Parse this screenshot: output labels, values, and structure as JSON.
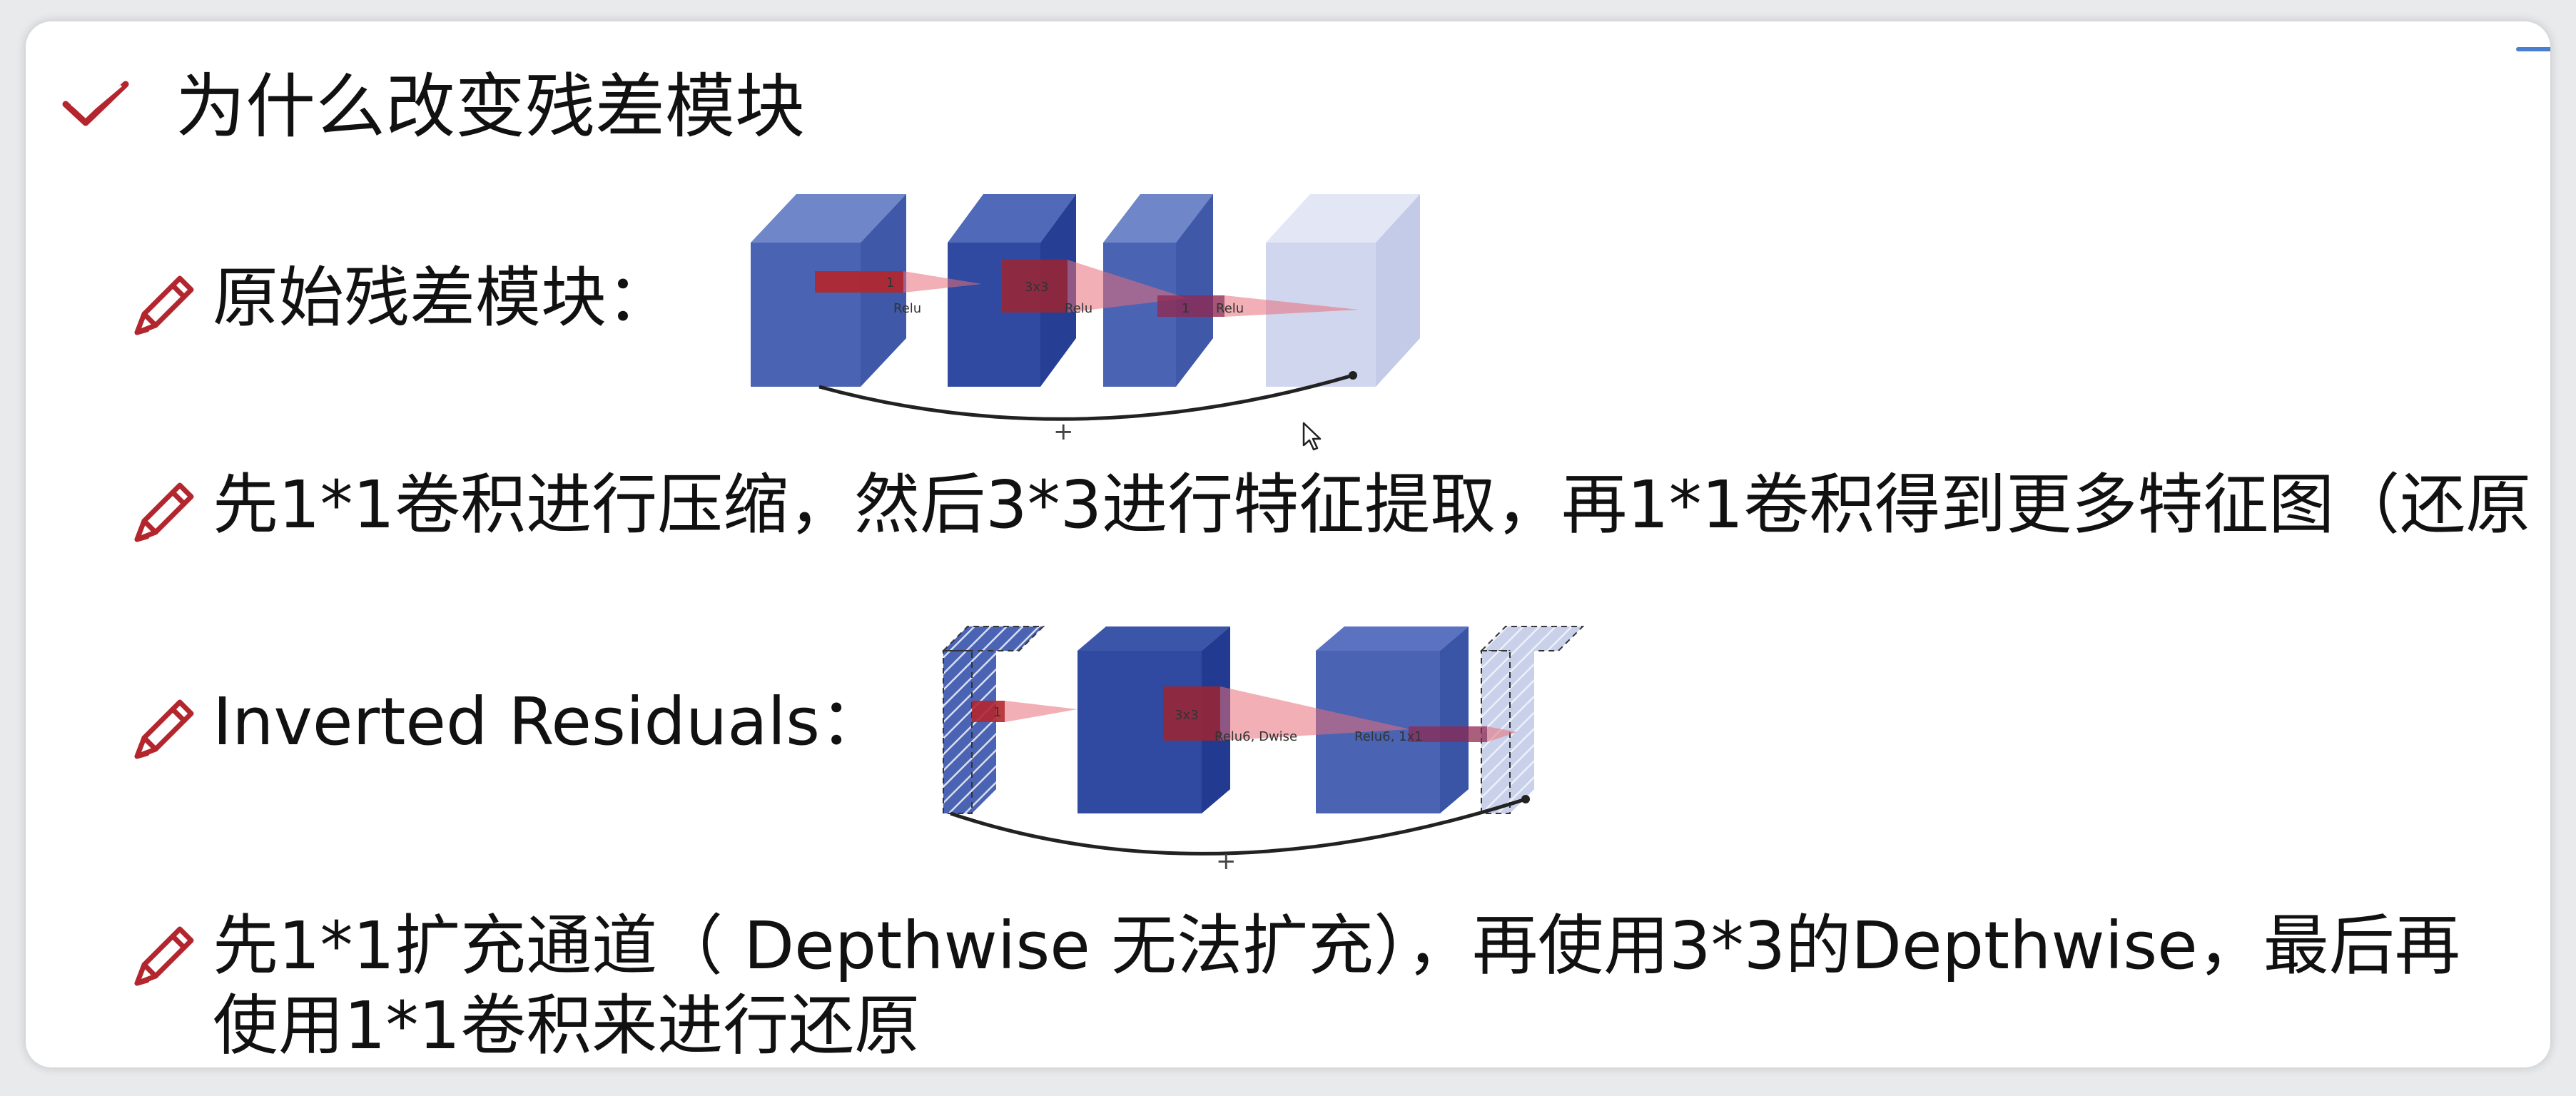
{
  "heading": "为什么改变残差模块",
  "bullets": [
    {
      "text": "原始残差模块："
    },
    {
      "text": "先1*1卷积进行压缩，然后3*3进行特征提取，再1*1卷积得到更多特征图（还原"
    },
    {
      "text": "Inverted Residuals："
    },
    {
      "line1": "先1*1扩充通道（ Depthwise 无法扩充），再使用3*3的Depthwise，最后再",
      "line2": "使用1*1卷积来进行还原"
    }
  ],
  "diagram1": {
    "labels": {
      "k1": "1",
      "k2": "3x3",
      "k3": "1",
      "relu1": "Relu",
      "relu2": "Relu",
      "relu3": "Relu",
      "plus": "+"
    }
  },
  "diagram2": {
    "labels": {
      "k1": "1",
      "k2": "3x3",
      "relu1": "Relu6, Dwise",
      "relu2": "Relu6, 1x1",
      "plus": "+"
    }
  },
  "colors": {
    "accent_red": "#b3262e",
    "block_blue": "#4a63b3",
    "block_dark": "#2f4aa0",
    "block_light": "#d0d6ee"
  },
  "icons": {
    "heading": "check-icon",
    "bullet": "pencil-icon",
    "pointer": "cursor-icon"
  }
}
